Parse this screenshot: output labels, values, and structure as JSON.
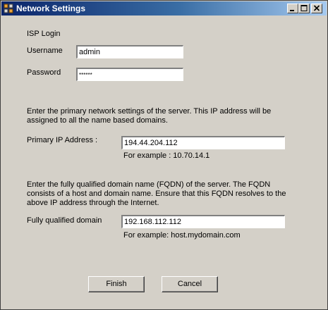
{
  "window": {
    "title": "Network Settings"
  },
  "isp": {
    "heading": "ISP Login",
    "username_label": "Username",
    "username_value": "admin",
    "password_label": "Password",
    "password_value": "******"
  },
  "primary": {
    "description": "Enter the primary network settings of the server. This IP address will be assigned to all the name based domains.",
    "ip_label": "Primary IP Address :",
    "ip_value": "194.44.204.112",
    "example": "For example : 10.70.14.1"
  },
  "fqdn": {
    "description": "Enter the fully qualified domain name (FQDN) of the server. The FQDN consists of a host and domain name. Ensure that this FQDN resolves to the above IP address through the Internet.",
    "label": "Fully qualified domain",
    "value": "192.168.112.112",
    "example": "For example: host.mydomain.com"
  },
  "buttons": {
    "finish": "Finish",
    "cancel": "Cancel"
  },
  "colors": {
    "title_gradient_start": "#0a246a",
    "title_gradient_end": "#a6caf0",
    "face": "#d4d0c8"
  },
  "icons": {
    "app": "network-settings-icon",
    "minimize": "minimize-icon",
    "maximize": "maximize-icon",
    "close": "close-icon"
  }
}
